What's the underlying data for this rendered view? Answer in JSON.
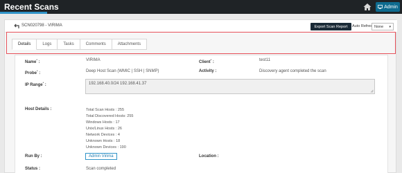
{
  "topbar": {
    "title": "Recent Scans",
    "admin_label": "Admin"
  },
  "header": {
    "scan_id": "SCN020798 - VIRIMA",
    "export_label": "Export Scan Report",
    "auto_refresh_label": "Auto Refresh:",
    "auto_refresh_value": "None"
  },
  "tabs": [
    "Details",
    "Logs",
    "Tasks",
    "Comments",
    "Attachments"
  ],
  "details": {
    "name_label": "Name",
    "name_value": "VIRIMA",
    "client_label": "Client",
    "client_value": "test11",
    "probe_label": "Probe",
    "probe_value": "Deep Host Scan (WMIC | SSH | SNMP)",
    "activity_label": "Activity :",
    "activity_value": "Discovery agent completed the scan",
    "ip_label": "IP Range",
    "ip_value": "192.168.40.0/24 192.168.41.37",
    "host_label": "Host Details :",
    "host_lines": [
      "Total Scan Hosts : 255",
      "Total Discovered Hosts: 255",
      "Windows Hosts : 17",
      "Unix/Linux Hosts : 26",
      "Network Devices : 4",
      "Unknown Hosts : 18",
      "Unknown Devices : 190"
    ],
    "runby_label": "Run By :",
    "runby_value": "Admin Virima",
    "location_label": "Location :",
    "status_label": "Status :",
    "status_value": "Scan completed"
  },
  "colors": {
    "topbar_bg": "#1f2326",
    "accent": "#2f93c8",
    "highlight": "#e7515a"
  }
}
